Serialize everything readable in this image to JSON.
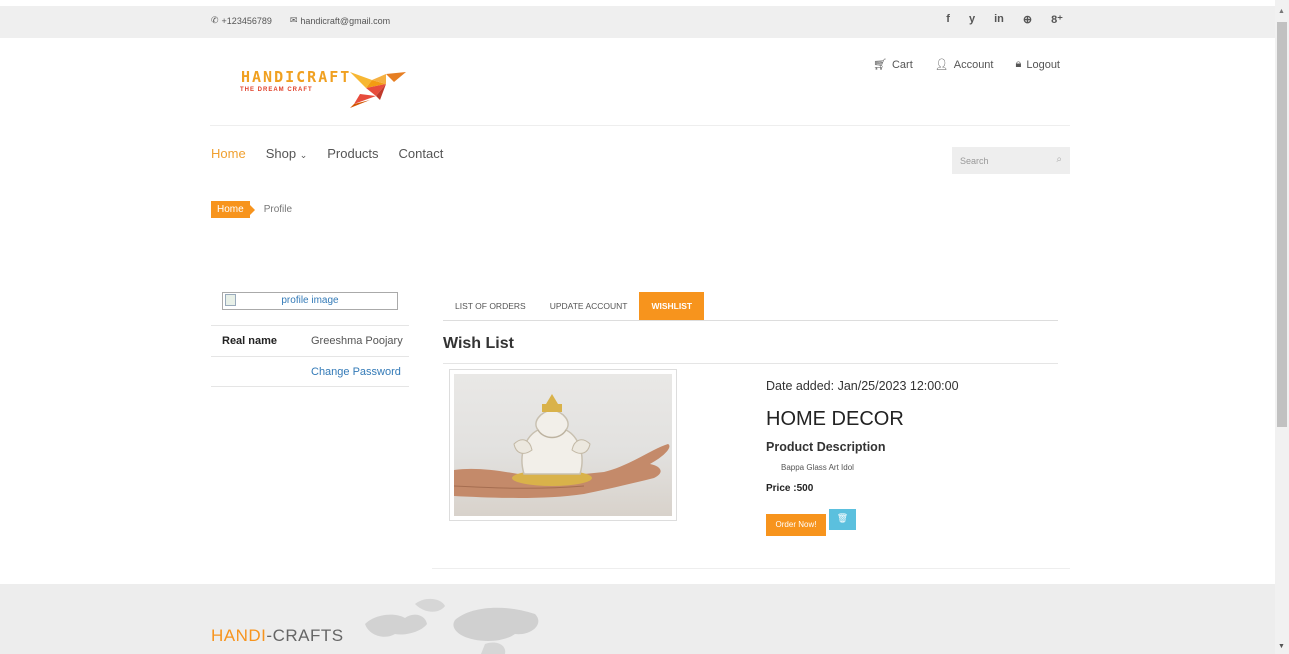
{
  "topbar": {
    "phone": "+123456789",
    "email": "handicraft@gmail.com",
    "social": [
      "f",
      "y",
      "in",
      "⊕",
      "8⁺"
    ]
  },
  "logo": {
    "brand": "HANDICRAFT",
    "tagline": "THE DREAM CRAFT"
  },
  "account_links": {
    "cart": "Cart",
    "account": "Account",
    "logout": "Logout"
  },
  "nav": {
    "items": [
      "Home",
      "Shop",
      "Products",
      "Contact"
    ]
  },
  "search": {
    "placeholder": "Search"
  },
  "breadcrumb": {
    "home": "Home",
    "current": "Profile"
  },
  "profile": {
    "image_alt": "profile image",
    "real_name_label": "Real name",
    "real_name": "Greeshma Poojary",
    "change_password": "Change Password"
  },
  "tabs": [
    "LIST OF ORDERS",
    "UPDATE ACCOUNT",
    "WISHLIST"
  ],
  "wishlist": {
    "title": "Wish List",
    "date_added": "Date added: Jan/25/2023 12:00:00",
    "category": "HOME DECOR",
    "desc_heading": "Product Description",
    "description": "Bappa Glass Art Idol",
    "price": "Price :500",
    "order_button": "Order Now!"
  },
  "footer": {
    "title_hl": "HANDI",
    "title_rest": "-CRAFTS"
  },
  "colors": {
    "accent": "#f7941d",
    "info": "#5bc0de",
    "link": "#337ab7"
  }
}
